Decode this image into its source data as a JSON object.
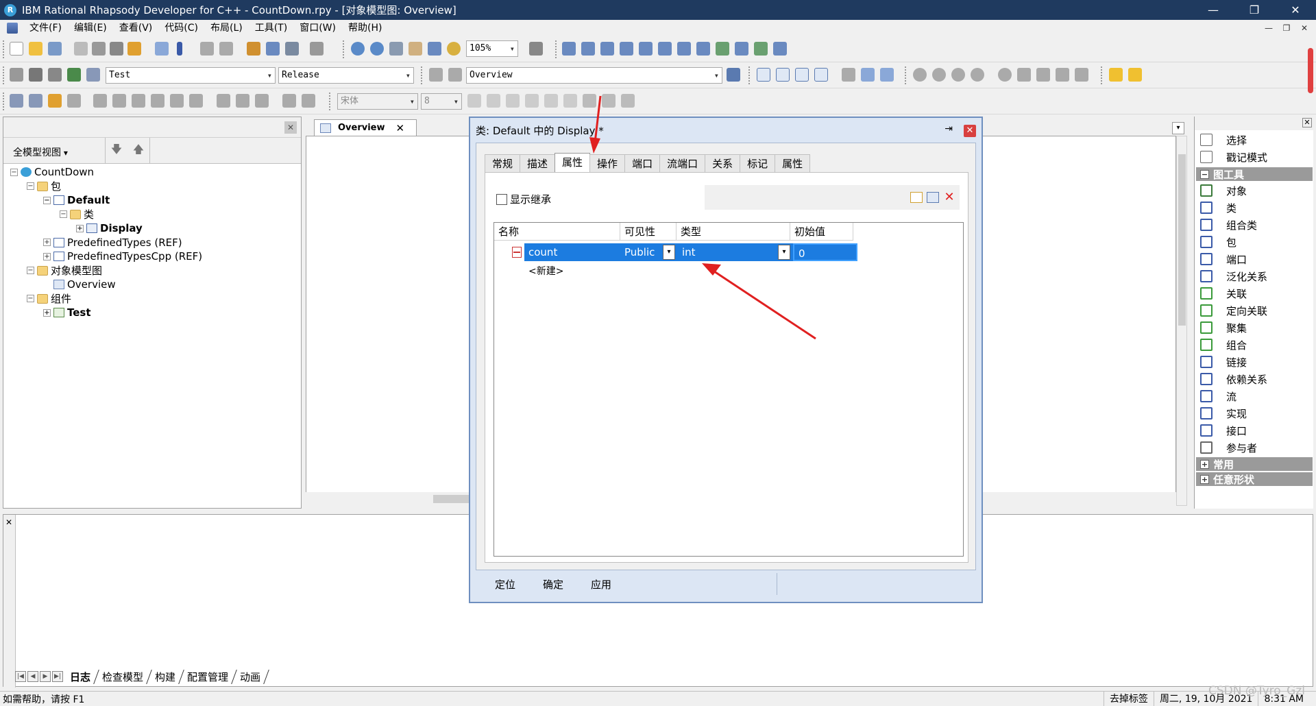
{
  "window": {
    "title": "IBM Rational Rhapsody Developer for C++ - CountDown.rpy - [对象模型图: Overview]",
    "app_icon_letter": "R",
    "minimize": "—",
    "maximize": "❐",
    "close": "✕"
  },
  "menu": {
    "items": [
      "文件(F)",
      "编辑(E)",
      "查看(V)",
      "代码(C)",
      "布局(L)",
      "工具(T)",
      "窗口(W)",
      "帮助(H)"
    ],
    "mdi_minimize": "—",
    "mdi_restore": "❐",
    "mdi_close": "✕"
  },
  "toolbar": {
    "zoom_value": "105%",
    "component_value": "Test",
    "config_value": "Release",
    "diagram_value": "Overview",
    "font_value": "宋体",
    "font_size_value": "8"
  },
  "browser": {
    "view_selector": "全模型视图",
    "close": "✕",
    "down_arrow": "🡇",
    "up_arrow": "🡅",
    "tree": [
      {
        "label": "CountDown",
        "level": 0,
        "icon": "project-icon",
        "bold": false,
        "expander": "−"
      },
      {
        "label": "包",
        "level": 1,
        "icon": "folder-icon",
        "bold": false,
        "expander": "−"
      },
      {
        "label": "Default",
        "level": 2,
        "icon": "package-icon",
        "bold": true,
        "expander": "−"
      },
      {
        "label": "类",
        "level": 3,
        "icon": "folder-icon",
        "bold": false,
        "expander": "−"
      },
      {
        "label": "Display",
        "level": 4,
        "icon": "class-icon",
        "bold": true,
        "expander": "+"
      },
      {
        "label": "PredefinedTypes (REF)",
        "level": 2,
        "icon": "package-icon",
        "bold": false,
        "expander": "+"
      },
      {
        "label": "PredefinedTypesCpp (REF)",
        "level": 2,
        "icon": "package-icon",
        "bold": false,
        "expander": "+"
      },
      {
        "label": "对象模型图",
        "level": 1,
        "icon": "folder-icon",
        "bold": false,
        "expander": "−"
      },
      {
        "label": "Overview",
        "level": 2,
        "icon": "diagram-icon",
        "bold": false,
        "expander": ""
      },
      {
        "label": "组件",
        "level": 1,
        "icon": "folder-icon",
        "bold": false,
        "expander": "−"
      },
      {
        "label": "Test",
        "level": 2,
        "icon": "component-icon",
        "bold": true,
        "expander": "+"
      }
    ]
  },
  "document": {
    "tab_label": "Overview",
    "tab_close": "✕",
    "tab_dropdown": "▾"
  },
  "toolbox": {
    "close": "✕",
    "top_items": [
      {
        "label": "选择",
        "icon": "cursor-icon",
        "color": "#666666"
      },
      {
        "label": "戳记模式",
        "icon": "stamp-icon",
        "color": "#666666"
      }
    ],
    "section_diagram_tools": "图工具",
    "section_expander": "−",
    "tools": [
      {
        "label": "对象",
        "icon": "object-icon",
        "color": "#3a7a3a"
      },
      {
        "label": "类",
        "icon": "class-icon",
        "color": "#3a5aa8"
      },
      {
        "label": "组合类",
        "icon": "composite-class-icon",
        "color": "#3a5aa8"
      },
      {
        "label": "包",
        "icon": "package-icon",
        "color": "#3a5aa8"
      },
      {
        "label": "端口",
        "icon": "port-icon",
        "color": "#3a5aa8"
      },
      {
        "label": "泛化关系",
        "icon": "generalization-icon",
        "color": "#3a5aa8"
      },
      {
        "label": "关联",
        "icon": "association-icon",
        "color": "#3a9a3a"
      },
      {
        "label": "定向关联",
        "icon": "directed-association-icon",
        "color": "#3a9a3a"
      },
      {
        "label": "聚集",
        "icon": "aggregation-icon",
        "color": "#3a9a3a"
      },
      {
        "label": "组合",
        "icon": "composition-icon",
        "color": "#3a9a3a"
      },
      {
        "label": "链接",
        "icon": "link-icon",
        "color": "#3a5aa8"
      },
      {
        "label": "依赖关系",
        "icon": "dependency-icon",
        "color": "#3a5aa8"
      },
      {
        "label": "流",
        "icon": "flow-icon",
        "color": "#3a5aa8"
      },
      {
        "label": "实现",
        "icon": "realization-icon",
        "color": "#3a5aa8"
      },
      {
        "label": "接口",
        "icon": "interface-icon",
        "color": "#3a5aa8"
      },
      {
        "label": "参与者",
        "icon": "actor-icon",
        "color": "#666666"
      }
    ],
    "section_common": "常用",
    "section_free_shapes": "任意形状",
    "section_collapsed": "+"
  },
  "dialog": {
    "title": "类: Default 中的 Display *",
    "pin": "⇥",
    "close": "✕",
    "tabs": [
      "常规",
      "描述",
      "属性",
      "操作",
      "端口",
      "流端口",
      "关系",
      "标记",
      "属性"
    ],
    "active_tab_index": 2,
    "show_inherited_label": "显示继承",
    "columns": [
      "名称",
      "可见性",
      "类型",
      "初始值"
    ],
    "row": {
      "name": "count",
      "visibility": "Public",
      "type": "int",
      "initial_value": "0"
    },
    "dropdown_arrow": "▾",
    "new_row_label": "<新建>",
    "footer_buttons": [
      "定位",
      "确定",
      "应用"
    ]
  },
  "output": {
    "close": "✕",
    "nav_buttons": [
      "|◀",
      "◀",
      "▶",
      "▶|"
    ],
    "tabs": [
      "日志",
      "检查模型",
      "构建",
      "配置管理",
      "动画"
    ],
    "active_tab_index": 0
  },
  "status": {
    "help_text": "如需帮助，请按 F1",
    "right_items": [
      "去掉标签",
      "周二, 19, 10月 2021",
      "8:31 AM"
    ],
    "watermark": "CSDN @Tyro_Gzl"
  },
  "colors": {
    "titlebar_bg": "#1f3a5f",
    "selection_blue": "#1c7ce0",
    "annotation_red": "#e02020",
    "dialog_border": "#6e8fbf"
  }
}
